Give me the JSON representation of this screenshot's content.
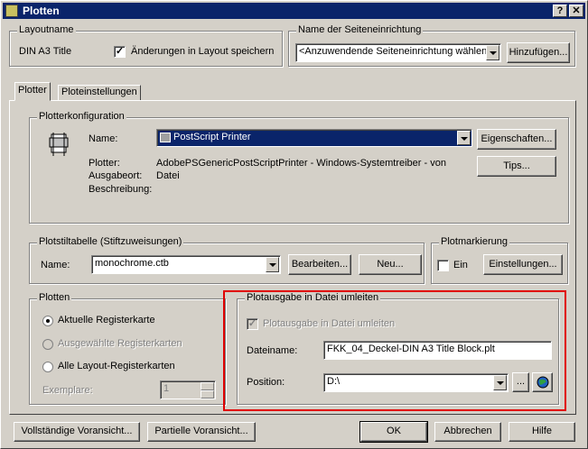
{
  "window": {
    "title": "Plotten",
    "help_btn": "?",
    "close_btn": "✕"
  },
  "layout_group": {
    "legend": "Layoutname",
    "name": "DIN A3 Title",
    "save_checkbox": "✓",
    "save_label": "Änderungen in Layout speichern"
  },
  "pagesetup_group": {
    "legend": "Name der Seiteneinrichtung",
    "select_value": "<Anzuwendende Seiteneinrichtung wählen>",
    "add_button": "Hinzufügen..."
  },
  "tabs": [
    {
      "label": "Plotter"
    },
    {
      "label": "Ploteinstellungen"
    }
  ],
  "plotter_config": {
    "legend": "Plotterkonfiguration",
    "name_label": "Name:",
    "name_value": "PostScript Printer",
    "plotter_label": "Plotter:",
    "plotter_value": "AdobePSGenericPostScriptPrinter - Windows-Systemtreiber - von",
    "location_label": "Ausgabeort:",
    "location_value": "Datei",
    "description_label": "Beschreibung:",
    "properties_button": "Eigenschaften...",
    "tips_button": "Tips..."
  },
  "plotstyle": {
    "legend": "Plotstiltabelle (Stiftzuweisungen)",
    "name_label": "Name:",
    "name_value": "monochrome.ctb",
    "edit_button": "Bearbeiten...",
    "new_button": "Neu..."
  },
  "plotstamp": {
    "legend": "Plotmarkierung",
    "on_label": "Ein",
    "settings_button": "Einstellungen..."
  },
  "plot_group": {
    "legend": "Plotten",
    "radio_current": "Aktuelle Registerkarte",
    "radio_selected": "Ausgewählte Registerkarten",
    "radio_all": "Alle Layout-Registerkarten",
    "copies_label": "Exemplare:",
    "copies_value": "1"
  },
  "file_output": {
    "legend": "Plotausgabe in Datei umleiten",
    "checkbox_mark": "✓",
    "checkbox_label": "Plotausgabe in Datei umleiten",
    "filename_label": "Dateiname:",
    "filename_value": "FKK_04_Deckel-DIN A3 Title Block.plt",
    "position_label": "Position:",
    "position_value": "D:\\",
    "browse_button": "...",
    "highlight_color": "#e00000"
  },
  "footer": {
    "full_preview": "Vollständige Voransicht...",
    "partial_preview": "Partielle Voransicht...",
    "ok": "OK",
    "cancel": "Abbrechen",
    "help": "Hilfe"
  },
  "colors": {
    "titlebar": "#0a246a",
    "face": "#d4d0c8",
    "selection": "#0a246a"
  }
}
